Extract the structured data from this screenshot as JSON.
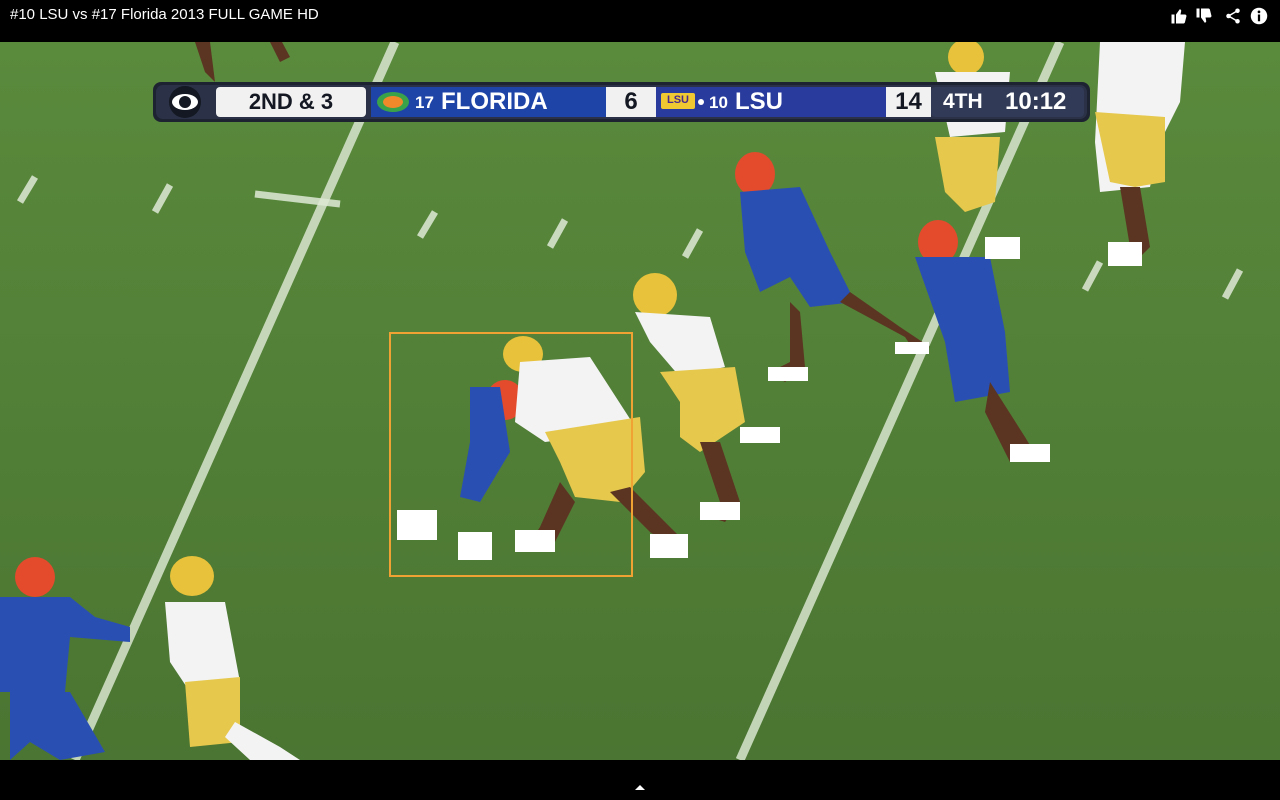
{
  "window": {
    "title": "#10 LSU vs #17 Florida 2013 FULL GAME HD"
  },
  "top_icons": [
    "thumbs-up-icon",
    "thumbs-down-icon",
    "share-icon",
    "info-icon"
  ],
  "scorebug": {
    "network": "CBS",
    "down_distance": "2ND & 3",
    "team1_rank": "17",
    "team1_name": "FLORIDA",
    "team1_score": "6",
    "team2_logo": "LSU",
    "team2_rank": "10",
    "team2_name": "LSU",
    "team2_score": "14",
    "quarter": "4TH",
    "clock": "10:12"
  },
  "colors": {
    "field_green": "#517c36",
    "florida_blue": "#1f44a8",
    "lsu_gold": "#e6c84d",
    "highlight_box": "#f0a233"
  },
  "bottom": {
    "expand_icon": "chevron-up-icon"
  }
}
